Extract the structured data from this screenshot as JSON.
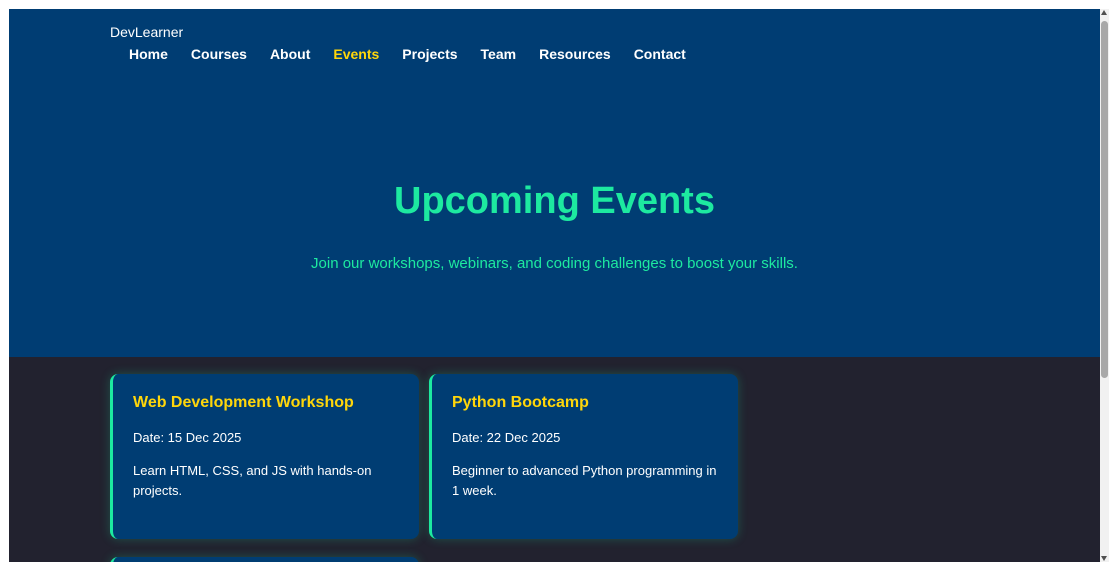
{
  "header": {
    "brand": "DevLearner",
    "nav": [
      {
        "label": "Home"
      },
      {
        "label": "Courses"
      },
      {
        "label": "About"
      },
      {
        "label": "Events"
      },
      {
        "label": "Projects"
      },
      {
        "label": "Team"
      },
      {
        "label": "Resources"
      },
      {
        "label": "Contact"
      }
    ],
    "active_nav": "Events"
  },
  "hero": {
    "title": "Upcoming Events",
    "subtitle": "Join our workshops, webinars, and coding challenges to boost your skills."
  },
  "events": [
    {
      "title": "Web Development Workshop",
      "date": "Date: 15 Dec 2025",
      "description": "Learn HTML, CSS, and JS with hands-on projects."
    },
    {
      "title": "Python Bootcamp",
      "date": "Date: 22 Dec 2025",
      "description": "Beginner to advanced Python programming in 1 week."
    }
  ],
  "colors": {
    "header_bg": "#003d73",
    "page_bg": "#22222f",
    "accent_green": "#1de9a0",
    "accent_yellow": "#ffd60a",
    "text": "#ffffff"
  }
}
